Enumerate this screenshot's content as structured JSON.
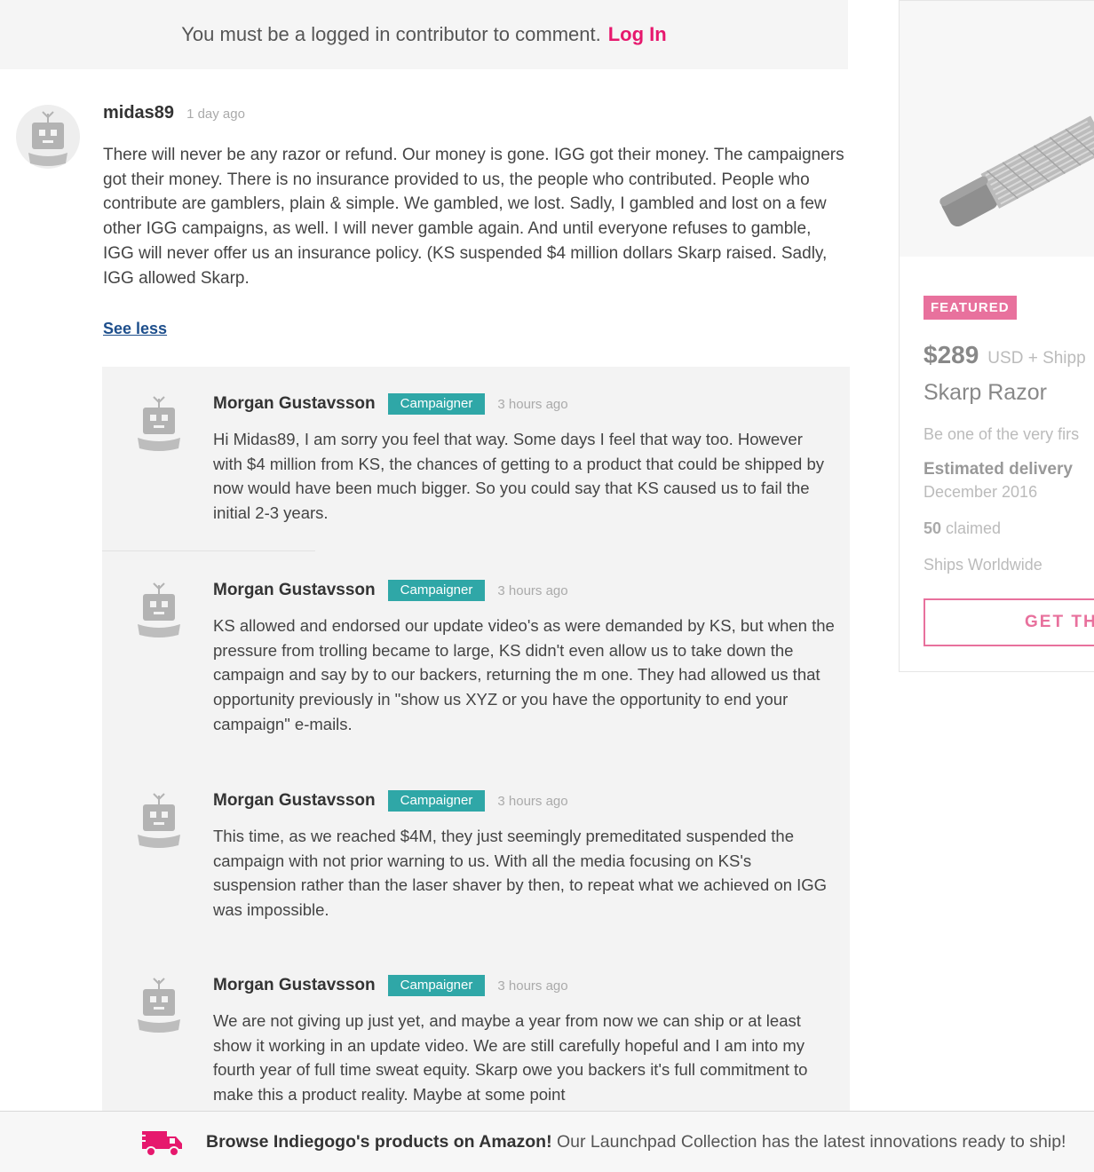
{
  "login_bar": {
    "message": "You must be a logged in contributor to comment.",
    "login_label": "Log In"
  },
  "main_comment": {
    "author": "midas89",
    "time": "1 day ago",
    "text": "There will never be any razor or refund. Our money is gone. IGG got their money. The campaigners got their money. There is no insurance provided to us, the people who contributed. People who contribute are gamblers, plain & simple. We gambled, we lost. Sadly, I gambled and lost on a few other IGG campaigns, as well. I will never gamble again. And until everyone refuses to gamble, IGG will never offer us an insurance policy. (KS suspended $4 million dollars Skarp raised. Sadly, IGG allowed Skarp.",
    "see_less": "See less"
  },
  "replies": [
    {
      "author": "Morgan Gustavsson",
      "badge": "Campaigner",
      "time": "3 hours ago",
      "text": "Hi Midas89, I am sorry you feel that way. Some days I feel that way too. However with $4 million from KS, the chances of getting to a product that could be shipped by now would have been much bigger. So you could say that KS caused us to fail the initial 2-3 years."
    },
    {
      "author": "Morgan Gustavsson",
      "badge": "Campaigner",
      "time": "3 hours ago",
      "text": "KS allowed and endorsed our update video's as were demanded by KS, but when the pressure from trolling became to large, KS didn't even allow us to take down the campaign and say by to our backers, returning the m one. They had allowed us that opportunity previously in \"show us XYZ or you have the opportunity to end your campaign\" e-mails."
    },
    {
      "author": "Morgan Gustavsson",
      "badge": "Campaigner",
      "time": "3 hours ago",
      "text": "This time, as we reached $4M, they just seemingly premeditated suspended the campaign with not prior warning to us. With all the media focusing on KS's suspension rather than the laser shaver by then, to repeat what we achieved on IGG was impossible."
    },
    {
      "author": "Morgan Gustavsson",
      "badge": "Campaigner",
      "time": "3 hours ago",
      "text": "We are not giving up just yet, and maybe a year from now we can ship or at least show it working in an update video. We are still carefully hopeful and I am into my fourth year of full time sweat equity. Skarp owe you backers it's full commitment to make this a product reality. Maybe at some point"
    }
  ],
  "perk": {
    "featured": "FEATURED",
    "price": "$289",
    "currency": "USD + Shipp",
    "title": "Skarp Razor",
    "description": "Be one of the very firs",
    "delivery_label": "Estimated delivery",
    "delivery_date": "December 2016",
    "claimed_count": "50",
    "claimed_label": "claimed",
    "ships": "Ships Worldwide",
    "button_label": "GET TH"
  },
  "banner": {
    "bold_text": "Browse Indiegogo's products on Amazon!",
    "text": " Our Launchpad Collection has the latest innovations ready to ship!"
  },
  "colors": {
    "accent_pink": "#e6186d",
    "campaigner_badge": "#2fa7a7",
    "featured_badge": "#e8719d",
    "link_blue": "#1e4f8c"
  }
}
